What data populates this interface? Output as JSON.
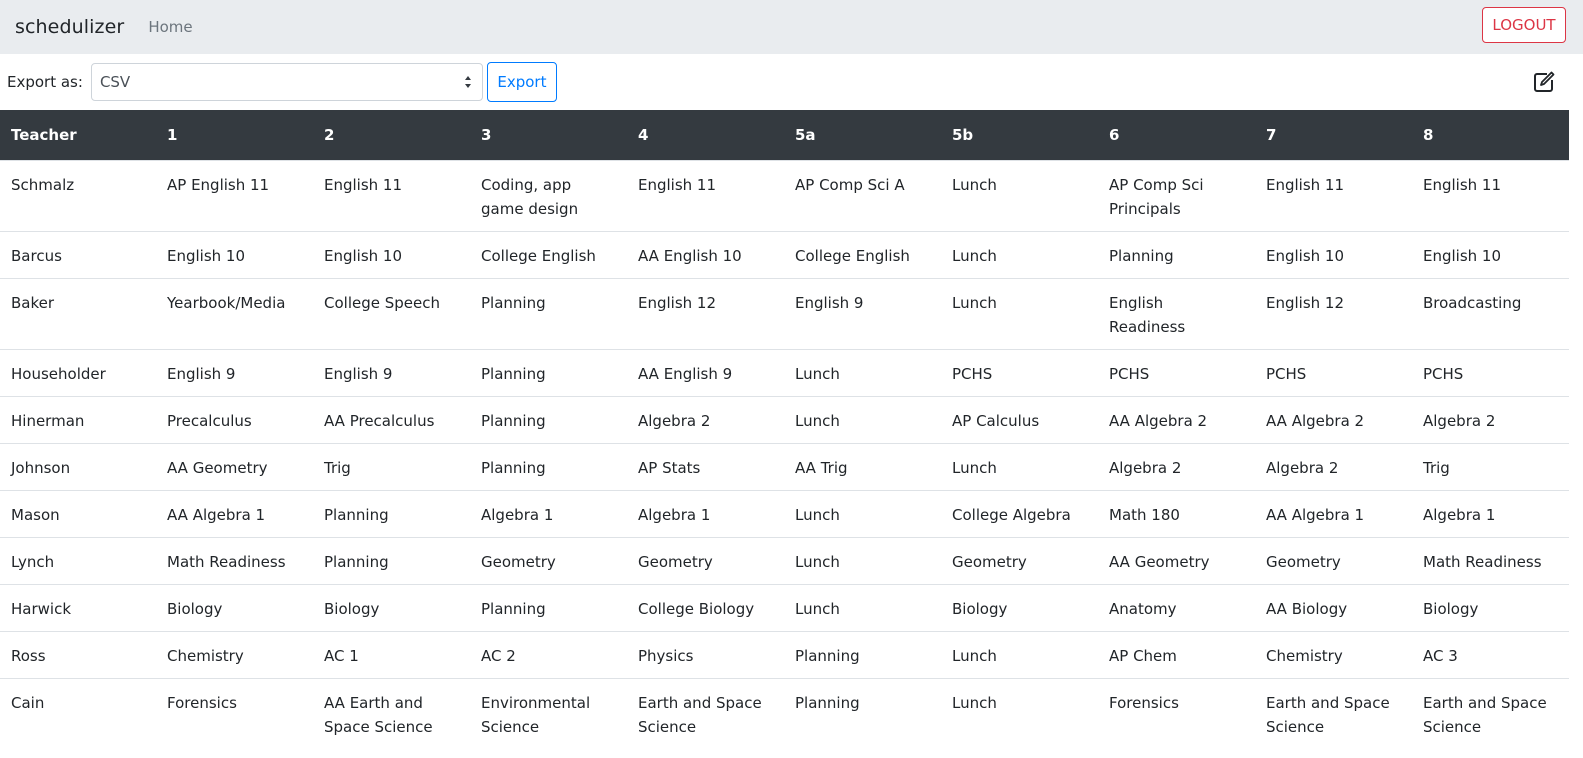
{
  "nav": {
    "brand": "schedulizer",
    "home": "Home",
    "logout": "LOGOUT"
  },
  "toolbar": {
    "export_label": "Export as:",
    "format_selected": "CSV",
    "export_button": "Export",
    "edit_icon": "edit-icon"
  },
  "table": {
    "headers": [
      "Teacher",
      "1",
      "2",
      "3",
      "4",
      "5a",
      "5b",
      "6",
      "7",
      "8"
    ],
    "rows": [
      [
        "Schmalz",
        "AP English 11",
        "English 11",
        "Coding, app game design",
        "English 11",
        "AP Comp Sci A",
        "Lunch",
        "AP Comp Sci Principals",
        "English 11",
        "English 11"
      ],
      [
        "Barcus",
        "English 10",
        "English 10",
        "College English",
        "AA English 10",
        "College English",
        "Lunch",
        "Planning",
        "English 10",
        "English 10"
      ],
      [
        "Baker",
        "Yearbook/Media",
        "College Speech",
        "Planning",
        "English 12",
        "English 9",
        "Lunch",
        "English Readiness",
        "English 12",
        "Broadcasting"
      ],
      [
        "Householder",
        "English 9",
        "English 9",
        "Planning",
        "AA English 9",
        "Lunch",
        "PCHS",
        "PCHS",
        "PCHS",
        "PCHS"
      ],
      [
        "Hinerman",
        "Precalculus",
        "AA Precalculus",
        "Planning",
        "Algebra 2",
        "Lunch",
        "AP Calculus",
        "AA Algebra 2",
        "AA Algebra 2",
        "Algebra 2"
      ],
      [
        "Johnson",
        "AA Geometry",
        "Trig",
        "Planning",
        "AP Stats",
        "AA Trig",
        "Lunch",
        "Algebra 2",
        "Algebra 2",
        "Trig"
      ],
      [
        "Mason",
        "AA Algebra 1",
        "Planning",
        "Algebra 1",
        "Algebra 1",
        "Lunch",
        "College Algebra",
        "Math 180",
        "AA Algebra 1",
        "Algebra 1"
      ],
      [
        "Lynch",
        "Math Readiness",
        "Planning",
        "Geometry",
        "Geometry",
        "Lunch",
        "Geometry",
        "AA Geometry",
        "Geometry",
        "Math Readiness"
      ],
      [
        "Harwick",
        "Biology",
        "Biology",
        "Planning",
        "College Biology",
        "Lunch",
        "Biology",
        "Anatomy",
        "AA Biology",
        "Biology"
      ],
      [
        "Ross",
        "Chemistry",
        "AC 1",
        "AC 2",
        "Physics",
        "Planning",
        "Lunch",
        "AP Chem",
        "Chemistry",
        "AC 3"
      ],
      [
        "Cain",
        "Forensics",
        "AA Earth and Space Science",
        "Environmental Science",
        "Earth and Space Science",
        "Planning",
        "Lunch",
        "Forensics",
        "Earth and Space Science",
        "Earth and Space Science"
      ]
    ]
  }
}
